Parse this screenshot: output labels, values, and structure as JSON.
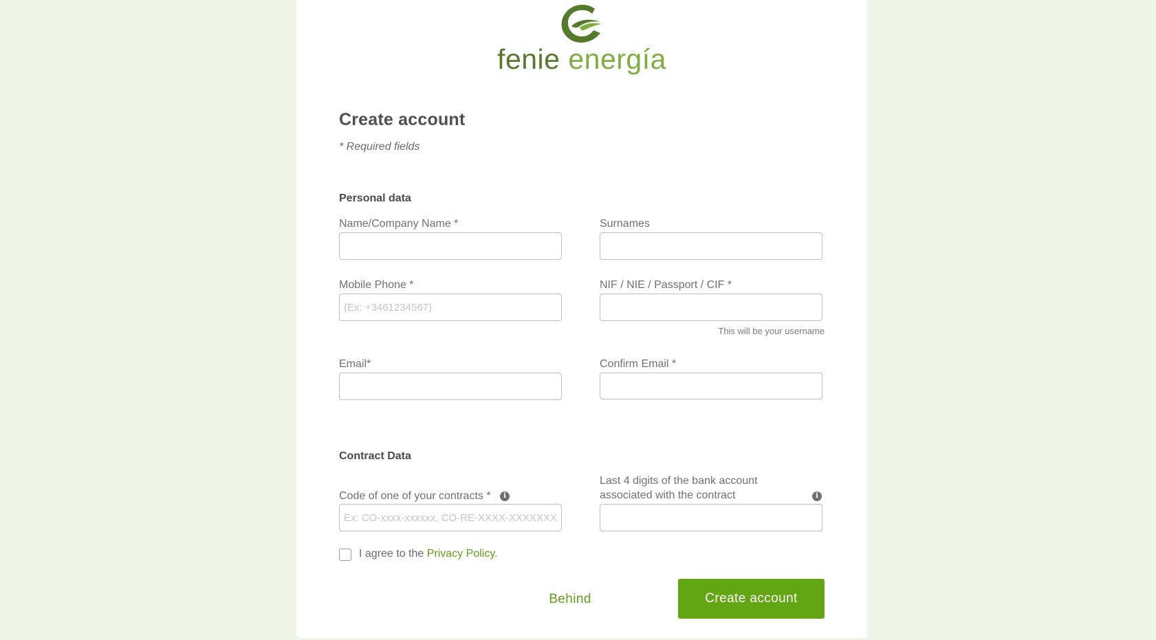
{
  "brand": {
    "word1": "fenie",
    "word2": "energía",
    "logo_icon": "fenie-energia-logo-icon",
    "color_dark": "#567a2b",
    "color_light": "#7fae3e"
  },
  "form": {
    "title": "Create account",
    "required_note": "* Required fields",
    "accent_color": "#62a613"
  },
  "personal": {
    "title": "Personal data",
    "name_label": "Name/Company Name *",
    "name_value": "",
    "surnames_label": "Surnames",
    "surnames_value": "",
    "mobile_label": "Mobile Phone *",
    "mobile_placeholder": "(Ex: +3461234567)",
    "nif_label": "NIF / NIE / Passport / CIF *",
    "nif_hint": "This will be your username",
    "email_label": "Email*",
    "confirm_email_label": "Confirm Email *"
  },
  "contract": {
    "title": "Contract Data",
    "code_label": "Code of one of your contracts *",
    "code_placeholder": "Ex: CO-xxxx-xxxxxx, CO-RE-XXXX-XXXXXXX",
    "bank_label": "Last 4 digits of the bank account associated with the contract",
    "info_icon": "info-icon",
    "info_glyph": "i"
  },
  "agreement": {
    "checked": false,
    "prefix": "I agree to the",
    "link": "Privacy Policy."
  },
  "actions": {
    "back_label": "Behind",
    "create_label": "Create account"
  }
}
